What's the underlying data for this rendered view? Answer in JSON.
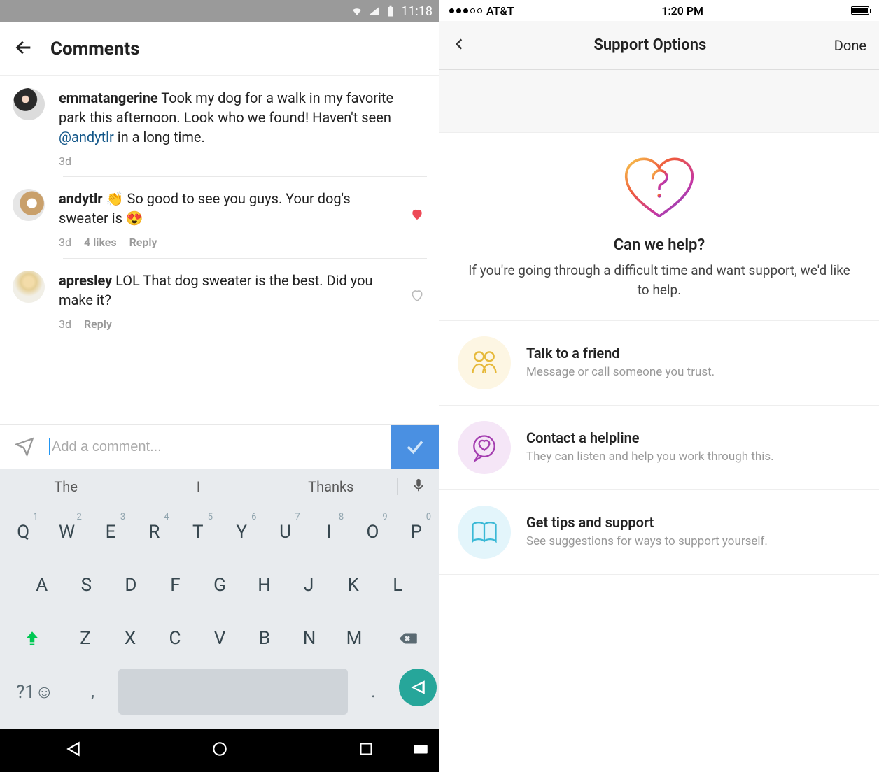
{
  "left": {
    "statusbar": {
      "time": "11:18"
    },
    "header": {
      "title": "Comments"
    },
    "comments": [
      {
        "user": "emmatangerine",
        "text_before": " Took my dog for a walk in my favorite park this afternoon. Look who we found! Haven't seen ",
        "mention": "@andytlr",
        "text_after": " in a long time.",
        "time": "3d",
        "likes": "",
        "reply": "",
        "liked": false,
        "show_heart": false
      },
      {
        "user": "andytlr",
        "text_before": " 👏 So good to see you guys. Your dog's sweater is 😍",
        "mention": "",
        "text_after": "",
        "time": "3d",
        "likes": "4 likes",
        "reply": "Reply",
        "liked": true,
        "show_heart": true
      },
      {
        "user": "apresley",
        "text_before": " LOL That dog sweater is the best. Did you make it?",
        "mention": "",
        "text_after": "",
        "time": "3d",
        "likes": "",
        "reply": "Reply",
        "liked": false,
        "show_heart": true
      }
    ],
    "compose": {
      "placeholder": "Add a comment..."
    },
    "keyboard": {
      "suggestions": [
        "The",
        "I",
        "Thanks"
      ],
      "row1": [
        "Q",
        "W",
        "E",
        "R",
        "T",
        "Y",
        "U",
        "I",
        "O",
        "P"
      ],
      "row1_hints": [
        "1",
        "2",
        "3",
        "4",
        "5",
        "6",
        "7",
        "8",
        "9",
        "0"
      ],
      "row2": [
        "A",
        "S",
        "D",
        "F",
        "G",
        "H",
        "J",
        "K",
        "L"
      ],
      "row3": [
        "Z",
        "X",
        "C",
        "V",
        "B",
        "N",
        "M"
      ],
      "row4_sym": "?1☺",
      "row4_comma": ",",
      "row4_period": "."
    }
  },
  "right": {
    "statusbar": {
      "carrier": "AT&T",
      "time": "1:20 PM"
    },
    "header": {
      "title": "Support Options",
      "done": "Done"
    },
    "hero": {
      "title": "Can we help?",
      "subtitle": "If you're going through a difficult time and want support, we'd like to help."
    },
    "options": [
      {
        "title": "Talk to a friend",
        "subtitle": "Message or call someone you trust."
      },
      {
        "title": "Contact a helpline",
        "subtitle": "They can listen and help you work through this."
      },
      {
        "title": "Get tips and support",
        "subtitle": "See suggestions for ways to support yourself."
      }
    ]
  }
}
